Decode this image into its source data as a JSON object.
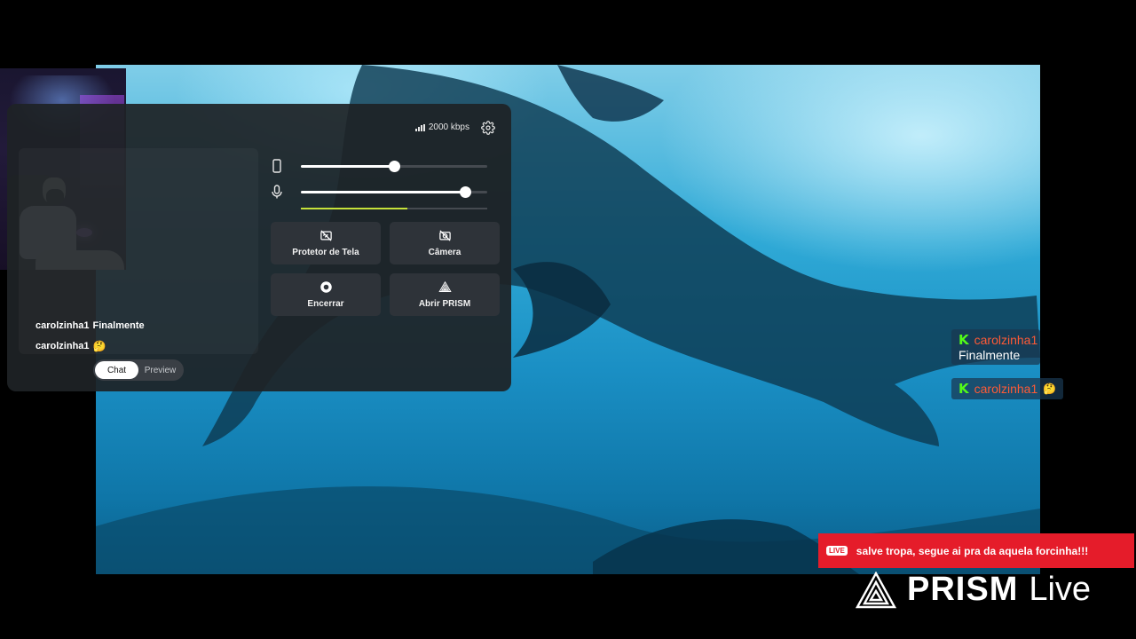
{
  "stream": {
    "bitrate": "2000 kbps"
  },
  "controls": {
    "buttons": [
      {
        "label": "Protetor de Tela",
        "icon": "screen-protect-icon"
      },
      {
        "label": "Câmera",
        "icon": "camera-off-icon"
      },
      {
        "label": "Encerrar",
        "icon": "stop-record-icon"
      },
      {
        "label": "Abrir PRISM",
        "icon": "prism-logo-icon"
      }
    ],
    "sliders": {
      "device_volume": 0.5,
      "mic_volume": 0.88,
      "mic_level": 0.57
    }
  },
  "panel_chat": {
    "messages": [
      {
        "user": "carolzinha1",
        "text": "Finalmente"
      },
      {
        "user": "carolzinha1",
        "text": "🤔"
      }
    ],
    "toggle": {
      "active": "Chat",
      "inactive": "Preview"
    }
  },
  "overlay_chat": {
    "messages": [
      {
        "user": "carolzinha1",
        "text": "Finalmente"
      },
      {
        "user": "carolzinha1",
        "text": "🤔"
      }
    ]
  },
  "banner": {
    "badge": "LIVE",
    "text": "salve tropa, segue ai pra da aquela forcinha!!!"
  },
  "brand": {
    "word1": "PRISM",
    "word2": "Live"
  },
  "colors": {
    "accent_level": "#c6e23a",
    "banner_red": "#e51c2a",
    "kick_green": "#53fc18",
    "username_overlay": "#ff5a36"
  }
}
